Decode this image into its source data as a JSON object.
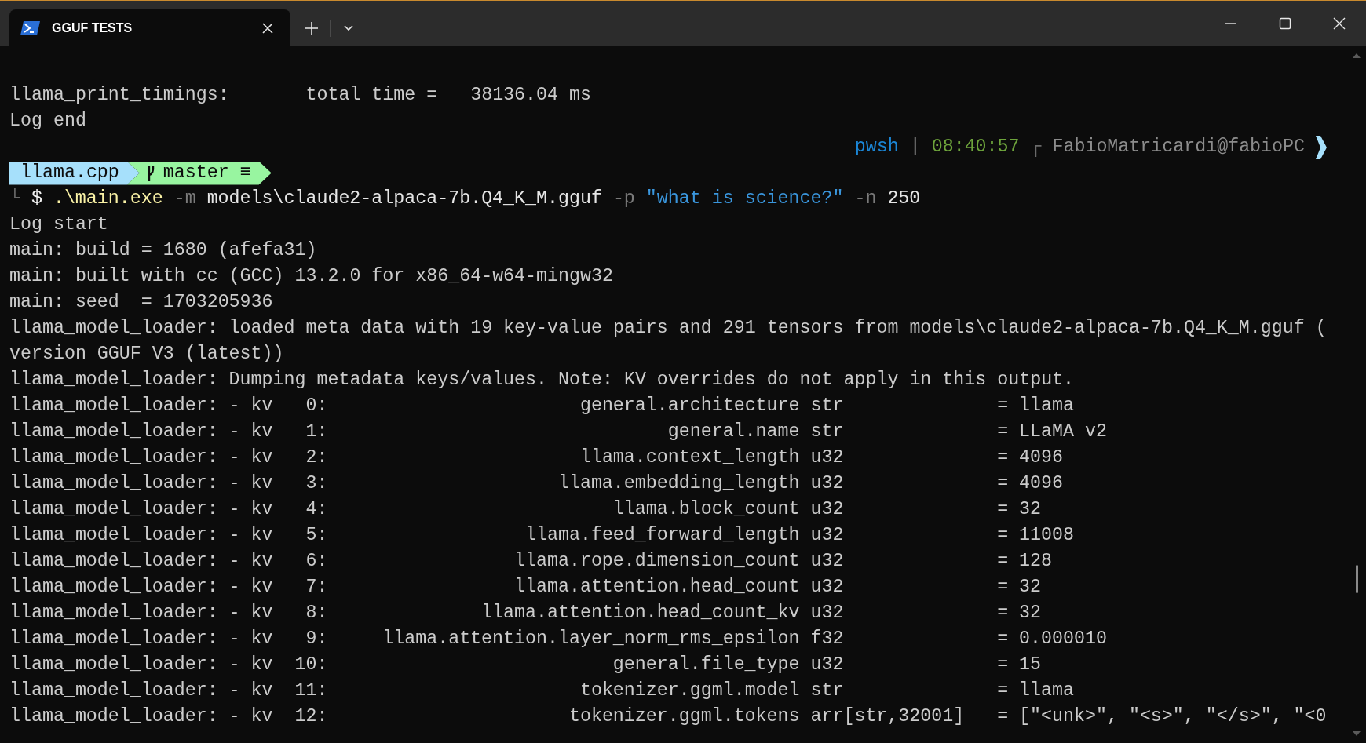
{
  "tab": {
    "title": "GGUF TESTS",
    "selected": true
  },
  "lines": [
    {
      "kind": "plain",
      "text": "llama_print_timings:       total time =   38136.04 ms"
    },
    {
      "kind": "plain",
      "text": "Log end"
    },
    {
      "kind": "right_prompt",
      "segments": [
        {
          "kind": "shell",
          "text": "pwsh"
        },
        {
          "kind": "sep",
          "text": "|"
        },
        {
          "kind": "time",
          "text": "08:40:57"
        },
        {
          "kind": "corner",
          "text": "┌"
        },
        {
          "kind": "user",
          "text": "FabioMatricardi@fabioPC"
        }
      ]
    },
    {
      "kind": "powerline",
      "segments": [
        {
          "kind": "path",
          "text": "llama.cpp"
        },
        {
          "kind": "git",
          "text": "master ≡"
        }
      ]
    },
    {
      "kind": "command",
      "segments": [
        {
          "kind": "corner",
          "text": "└"
        },
        {
          "kind": "sign",
          "text": "$"
        },
        {
          "kind": "exe",
          "text": ".\\main.exe"
        },
        {
          "kind": "flag",
          "text": "-m"
        },
        {
          "kind": "arg",
          "text": "models\\claude2-alpaca-7b.Q4_K_M.gguf"
        },
        {
          "kind": "flag",
          "text": "-p"
        },
        {
          "kind": "string",
          "text": "\"what is science?\""
        },
        {
          "kind": "flag",
          "text": "-n"
        },
        {
          "kind": "arg",
          "text": "250"
        }
      ]
    },
    {
      "kind": "plain",
      "text": "Log start"
    },
    {
      "kind": "plain",
      "text": "main: build = 1680 (afefa31)"
    },
    {
      "kind": "plain",
      "text": "main: built with cc (GCC) 13.2.0 for x86_64-w64-mingw32"
    },
    {
      "kind": "plain",
      "text": "main: seed  = 1703205936"
    },
    {
      "kind": "plain",
      "text": "llama_model_loader: loaded meta data with 19 key-value pairs and 291 tensors from models\\claude2-alpaca-7b.Q4_K_M.gguf ("
    },
    {
      "kind": "plain",
      "text": "version GGUF V3 (latest))"
    },
    {
      "kind": "plain",
      "text": "llama_model_loader: Dumping metadata keys/values. Note: KV overrides do not apply in this output."
    },
    {
      "kind": "kv",
      "prefix": "llama_model_loader: - kv",
      "index": "0:",
      "key": "general.architecture",
      "type": "str",
      "value": "= llama"
    },
    {
      "kind": "kv",
      "prefix": "llama_model_loader: - kv",
      "index": "1:",
      "key": "general.name",
      "type": "str",
      "value": "= LLaMA v2"
    },
    {
      "kind": "kv",
      "prefix": "llama_model_loader: - kv",
      "index": "2:",
      "key": "llama.context_length",
      "type": "u32",
      "value": "= 4096"
    },
    {
      "kind": "kv",
      "prefix": "llama_model_loader: - kv",
      "index": "3:",
      "key": "llama.embedding_length",
      "type": "u32",
      "value": "= 4096"
    },
    {
      "kind": "kv",
      "prefix": "llama_model_loader: - kv",
      "index": "4:",
      "key": "llama.block_count",
      "type": "u32",
      "value": "= 32"
    },
    {
      "kind": "kv",
      "prefix": "llama_model_loader: - kv",
      "index": "5:",
      "key": "llama.feed_forward_length",
      "type": "u32",
      "value": "= 11008"
    },
    {
      "kind": "kv",
      "prefix": "llama_model_loader: - kv",
      "index": "6:",
      "key": "llama.rope.dimension_count",
      "type": "u32",
      "value": "= 128"
    },
    {
      "kind": "kv",
      "prefix": "llama_model_loader: - kv",
      "index": "7:",
      "key": "llama.attention.head_count",
      "type": "u32",
      "value": "= 32"
    },
    {
      "kind": "kv",
      "prefix": "llama_model_loader: - kv",
      "index": "8:",
      "key": "llama.attention.head_count_kv",
      "type": "u32",
      "value": "= 32"
    },
    {
      "kind": "kv",
      "prefix": "llama_model_loader: - kv",
      "index": "9:",
      "key": "llama.attention.layer_norm_rms_epsilon",
      "type": "f32",
      "value": "= 0.000010"
    },
    {
      "kind": "kv",
      "prefix": "llama_model_loader: - kv",
      "index": "10:",
      "key": "general.file_type",
      "type": "u32",
      "value": "= 15"
    },
    {
      "kind": "kv",
      "prefix": "llama_model_loader: - kv",
      "index": "11:",
      "key": "tokenizer.ggml.model",
      "type": "str",
      "value": "= llama"
    },
    {
      "kind": "kv",
      "prefix": "llama_model_loader: - kv",
      "index": "12:",
      "key": "tokenizer.ggml.tokens",
      "type": "arr[str,32001]",
      "value": "= [\"<unk>\", \"<s>\", \"</s>\", \"<0"
    }
  ]
}
